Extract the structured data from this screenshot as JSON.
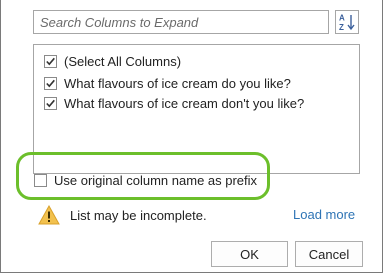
{
  "search": {
    "placeholder": "Search Columns to Expand",
    "value": ""
  },
  "sort_button": {
    "icon": "sort-az-icon"
  },
  "columns": {
    "items": [
      {
        "label": "(Select All Columns)",
        "checked": true
      },
      {
        "label": "What flavours of ice cream do you like?",
        "checked": true
      },
      {
        "label": "What flavours of ice cream don't you like?",
        "checked": true
      }
    ]
  },
  "prefix_option": {
    "label": "Use original column name as prefix",
    "checked": false
  },
  "warning": {
    "icon": "warning-icon",
    "text": "List may be incomplete.",
    "link": "Load more"
  },
  "buttons": {
    "ok": "OK",
    "cancel": "Cancel"
  },
  "colors": {
    "highlight": "#6cbf2b",
    "link": "#2e74b5",
    "warning": "#f2c14e"
  }
}
